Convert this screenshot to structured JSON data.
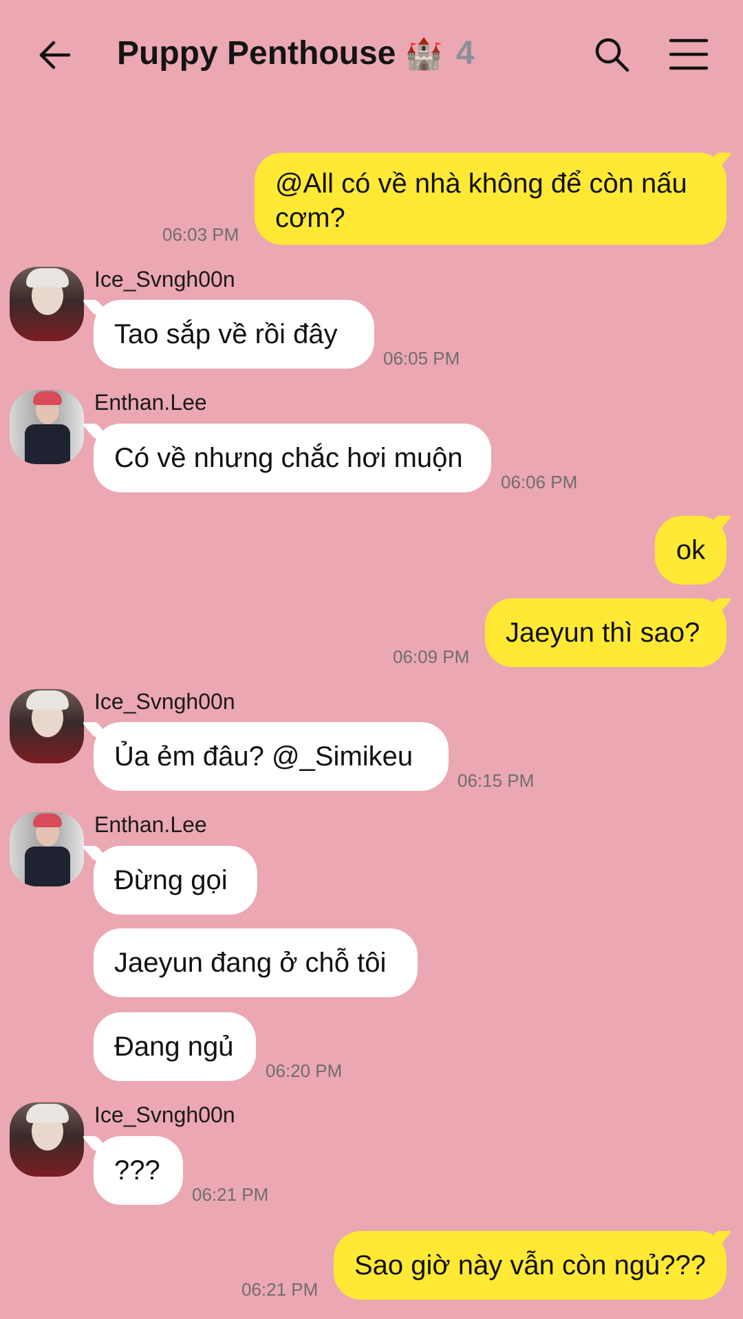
{
  "header": {
    "title": "Puppy Penthouse",
    "title_emoji": "🏰",
    "member_count": "4"
  },
  "users": {
    "ice": "Ice_Svngh00n",
    "enthan": "Enthan.Lee"
  },
  "messages": [
    {
      "side": "out",
      "lines": [
        "@All có về nhà không để còn nấu",
        "cơm?"
      ],
      "time": "06:03 PM"
    },
    {
      "side": "in",
      "sender": "Ice_Svngh00n",
      "text": "Tao sắp về rồi đây",
      "time": "06:05 PM"
    },
    {
      "side": "in",
      "sender": "Enthan.Lee",
      "text": "Có về nhưng chắc hơi muộn",
      "time": "06:06 PM"
    },
    {
      "side": "out",
      "text": "ok"
    },
    {
      "side": "out",
      "text": "Jaeyun thì sao?",
      "time": "06:09 PM"
    },
    {
      "side": "in",
      "sender": "Ice_Svngh00n",
      "text": "Ủa ẻm đâu? @_Simikeu",
      "time": "06:15 PM"
    },
    {
      "side": "in",
      "sender": "Enthan.Lee",
      "text": "Đừng gọi"
    },
    {
      "side": "in",
      "text": "Jaeyun đang ở chỗ tôi"
    },
    {
      "side": "in",
      "text": "Đang ngủ",
      "time": "06:20 PM"
    },
    {
      "side": "in",
      "sender": "Ice_Svngh00n",
      "text": "???",
      "time": "06:21 PM"
    },
    {
      "side": "out",
      "text": "Sao giờ này vẫn còn ngủ???",
      "time": "06:21 PM"
    }
  ],
  "colors": {
    "background": "#EBA7B2",
    "outgoing_bubble": "#FFE935",
    "incoming_bubble": "#FFFFFF",
    "count_gray": "#8A8F99"
  }
}
